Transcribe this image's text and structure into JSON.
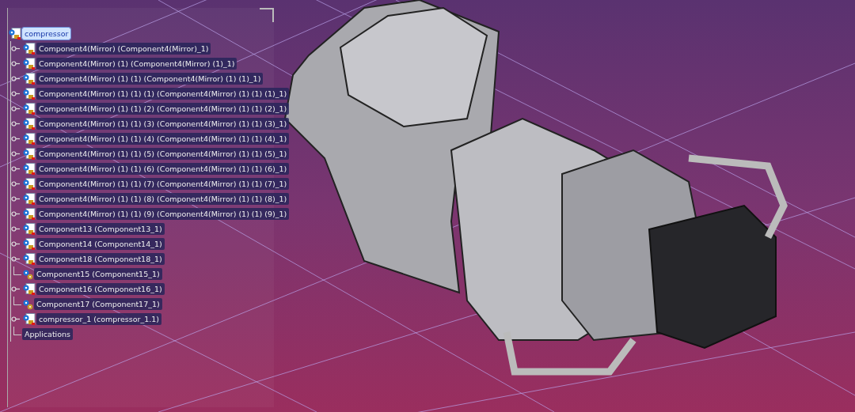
{
  "tree": {
    "root": {
      "label": "compressor",
      "selected": true
    },
    "items": [
      {
        "kind": "product",
        "label": "Component4(Mirror) (Component4(Mirror)_1)",
        "selected": false
      },
      {
        "kind": "product",
        "label": "Component4(Mirror) (1) (Component4(Mirror) (1)_1)",
        "selected": false
      },
      {
        "kind": "product",
        "label": "Component4(Mirror) (1) (1) (Component4(Mirror) (1) (1)_1)",
        "selected": false
      },
      {
        "kind": "product",
        "label": "Component4(Mirror) (1) (1) (1) (Component4(Mirror) (1) (1) (1)_1)",
        "selected": false
      },
      {
        "kind": "product",
        "label": "Component4(Mirror) (1) (1) (2) (Component4(Mirror) (1) (1) (2)_1)",
        "selected": false
      },
      {
        "kind": "product",
        "label": "Component4(Mirror) (1) (1) (3) (Component4(Mirror) (1) (1) (3)_1)",
        "selected": false
      },
      {
        "kind": "product",
        "label": "Component4(Mirror) (1) (1) (4) (Component4(Mirror) (1) (1) (4)_1)",
        "selected": false
      },
      {
        "kind": "product",
        "label": "Component4(Mirror) (1) (1) (5) (Component4(Mirror) (1) (1) (5)_1)",
        "selected": false
      },
      {
        "kind": "product",
        "label": "Component4(Mirror) (1) (1) (6) (Component4(Mirror) (1) (1) (6)_1)",
        "selected": false
      },
      {
        "kind": "product",
        "label": "Component4(Mirror) (1) (1) (7) (Component4(Mirror) (1) (1) (7)_1)",
        "selected": false
      },
      {
        "kind": "product",
        "label": "Component4(Mirror) (1) (1) (8) (Component4(Mirror) (1) (1) (8)_1)",
        "selected": false
      },
      {
        "kind": "product",
        "label": "Component4(Mirror) (1) (1) (9) (Component4(Mirror) (1) (1) (9)_1)",
        "selected": false
      },
      {
        "kind": "product",
        "label": "Component13 (Component13_1)",
        "selected": false
      },
      {
        "kind": "product",
        "label": "Component14 (Component14_1)",
        "selected": false
      },
      {
        "kind": "product",
        "label": "Component18 (Component18_1)",
        "selected": false
      },
      {
        "kind": "component",
        "label": "Component15 (Component15_1)",
        "selected": false
      },
      {
        "kind": "product",
        "label": "Component16 (Component16_1)",
        "selected": false
      },
      {
        "kind": "component",
        "label": "Component17 (Component17_1)",
        "selected": false
      },
      {
        "kind": "product",
        "label": "compressor_1 (compressor_1.1)",
        "selected": false
      },
      {
        "kind": "applications",
        "label": "Applications",
        "selected": false
      }
    ]
  }
}
